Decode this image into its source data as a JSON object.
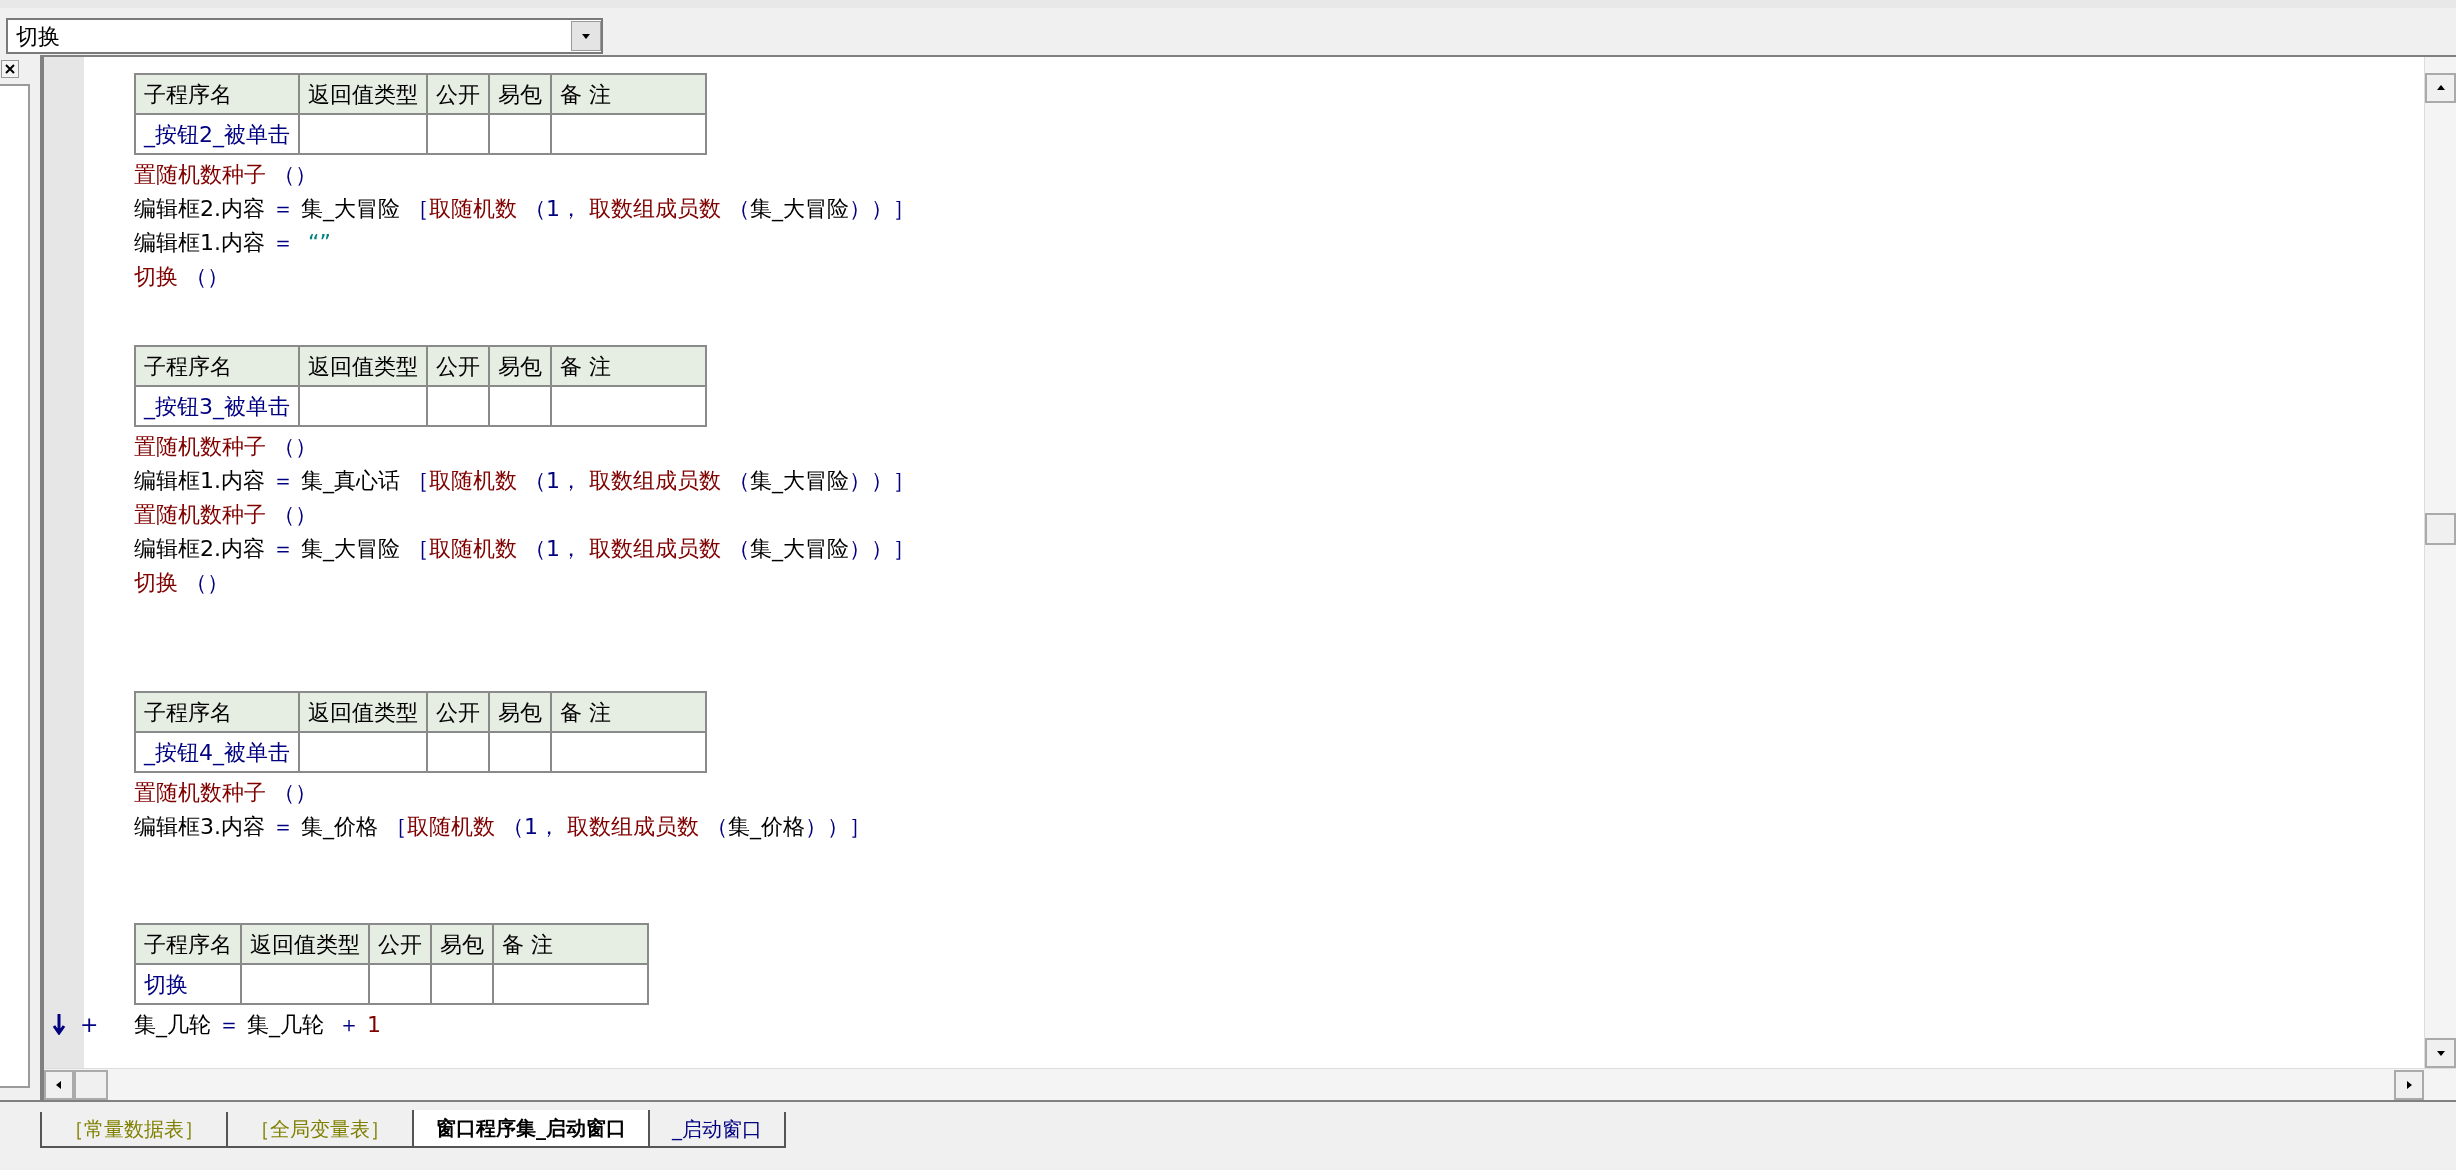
{
  "selector": {
    "value": "切换"
  },
  "blocks": [
    {
      "columns": [
        "子程序名",
        "返回值类型",
        "公开",
        "易包",
        "备 注"
      ],
      "subroutine": "_按钮2_被单击",
      "lines": [
        [
          {
            "kind": "call",
            "text": "置随机数种子"
          },
          {
            "kind": "symbol",
            "text": " （）"
          }
        ],
        [
          {
            "kind": "name",
            "text": "编辑框2.内容"
          },
          {
            "kind": "symbol",
            "text": " ＝ "
          },
          {
            "kind": "name",
            "text": "集_大冒险 "
          },
          {
            "kind": "symbol",
            "text": "［"
          },
          {
            "kind": "call",
            "text": "取随机数"
          },
          {
            "kind": "symbol",
            "text": " （1，"
          },
          {
            "kind": "call",
            "text": " 取数组成员数"
          },
          {
            "kind": "symbol",
            "text": " （"
          },
          {
            "kind": "name",
            "text": "集_大冒险"
          },
          {
            "kind": "symbol",
            "text": "））］"
          }
        ],
        [
          {
            "kind": "name",
            "text": "编辑框1.内容"
          },
          {
            "kind": "symbol",
            "text": " ＝ "
          },
          {
            "kind": "string",
            "text": " “”"
          }
        ],
        [
          {
            "kind": "call",
            "text": "切换"
          },
          {
            "kind": "symbol",
            "text": " （）"
          }
        ]
      ]
    },
    {
      "columns": [
        "子程序名",
        "返回值类型",
        "公开",
        "易包",
        "备 注"
      ],
      "subroutine": "_按钮3_被单击",
      "lines": [
        [
          {
            "kind": "call",
            "text": "置随机数种子"
          },
          {
            "kind": "symbol",
            "text": " （）"
          }
        ],
        [
          {
            "kind": "name",
            "text": "编辑框1.内容"
          },
          {
            "kind": "symbol",
            "text": " ＝ "
          },
          {
            "kind": "name",
            "text": "集_真心话 "
          },
          {
            "kind": "symbol",
            "text": "［"
          },
          {
            "kind": "call",
            "text": "取随机数"
          },
          {
            "kind": "symbol",
            "text": " （1，"
          },
          {
            "kind": "call",
            "text": " 取数组成员数"
          },
          {
            "kind": "symbol",
            "text": " （"
          },
          {
            "kind": "name",
            "text": "集_大冒险"
          },
          {
            "kind": "symbol",
            "text": "））］"
          }
        ],
        [
          {
            "kind": "call",
            "text": "置随机数种子"
          },
          {
            "kind": "symbol",
            "text": " （）"
          }
        ],
        [
          {
            "kind": "name",
            "text": "编辑框2.内容"
          },
          {
            "kind": "symbol",
            "text": " ＝ "
          },
          {
            "kind": "name",
            "text": "集_大冒险 "
          },
          {
            "kind": "symbol",
            "text": "［"
          },
          {
            "kind": "call",
            "text": "取随机数"
          },
          {
            "kind": "symbol",
            "text": " （1，"
          },
          {
            "kind": "call",
            "text": " 取数组成员数"
          },
          {
            "kind": "symbol",
            "text": " （"
          },
          {
            "kind": "name",
            "text": "集_大冒险"
          },
          {
            "kind": "symbol",
            "text": "））］"
          }
        ],
        [
          {
            "kind": "call",
            "text": "切换"
          },
          {
            "kind": "symbol",
            "text": " （）"
          }
        ]
      ]
    },
    {
      "columns": [
        "子程序名",
        "返回值类型",
        "公开",
        "易包",
        "备 注"
      ],
      "subroutine": "_按钮4_被单击",
      "lines": [
        [
          {
            "kind": "call",
            "text": "置随机数种子"
          },
          {
            "kind": "symbol",
            "text": " （）"
          }
        ],
        [
          {
            "kind": "name",
            "text": "编辑框3.内容"
          },
          {
            "kind": "symbol",
            "text": " ＝ "
          },
          {
            "kind": "name",
            "text": "集_价格 "
          },
          {
            "kind": "symbol",
            "text": "［"
          },
          {
            "kind": "call",
            "text": "取随机数"
          },
          {
            "kind": "symbol",
            "text": " （1，"
          },
          {
            "kind": "call",
            "text": " 取数组成员数"
          },
          {
            "kind": "symbol",
            "text": " （"
          },
          {
            "kind": "name",
            "text": "集_价格"
          },
          {
            "kind": "symbol",
            "text": "））］"
          }
        ]
      ]
    },
    {
      "columns": [
        "子程序名",
        "返回值类型",
        "公开",
        "易包",
        "备 注"
      ],
      "subroutine": "切换"
    }
  ],
  "current_line": {
    "marker": "+",
    "tokens": [
      {
        "kind": "name",
        "text": "集_几轮"
      },
      {
        "kind": "symbol",
        "text": " ＝ "
      },
      {
        "kind": "name",
        "text": "集_几轮 "
      },
      {
        "kind": "symbol",
        "text": " ＋ "
      },
      {
        "kind": "number",
        "text": "1"
      }
    ]
  },
  "tabs": [
    {
      "label": "［常量数据表］",
      "selected": false,
      "color": "#808000"
    },
    {
      "label": "［全局变量表］",
      "selected": false,
      "color": "#808000"
    },
    {
      "label": "窗口程序集_启动窗口",
      "selected": true,
      "color": "#000000"
    },
    {
      "label": "_启动窗口",
      "selected": false,
      "color": "#000080"
    }
  ]
}
